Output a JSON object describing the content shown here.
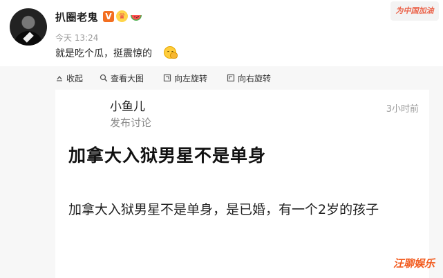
{
  "post": {
    "username": "扒圈老鬼",
    "verified_label": "V",
    "timestamp": "今天 13:24",
    "text": "就是吃个瓜，挺震惊的",
    "icons": [
      "avatar",
      "verified-icon",
      "crown-icon",
      "watermelon-icon",
      "emoji-shock-icon"
    ]
  },
  "watermark_top": "为中国加油",
  "toolbar": {
    "collapse": "收起",
    "view_large": "查看大图",
    "rotate_left": "向左旋转",
    "rotate_right": "向右旋转"
  },
  "card": {
    "author": "小鱼儿",
    "subtitle": "发布讨论",
    "time": "3小时前",
    "title": "加拿大入狱男星不是单身",
    "body": "加拿大入狱男星不是单身，是已婚，有一个2岁的孩子"
  },
  "watermark_bottom": "汪聊娱乐",
  "colors": {
    "brand": "#f36f21",
    "text": "#1f1f1f",
    "muted": "#999999",
    "panel": "#f7f7f7"
  }
}
